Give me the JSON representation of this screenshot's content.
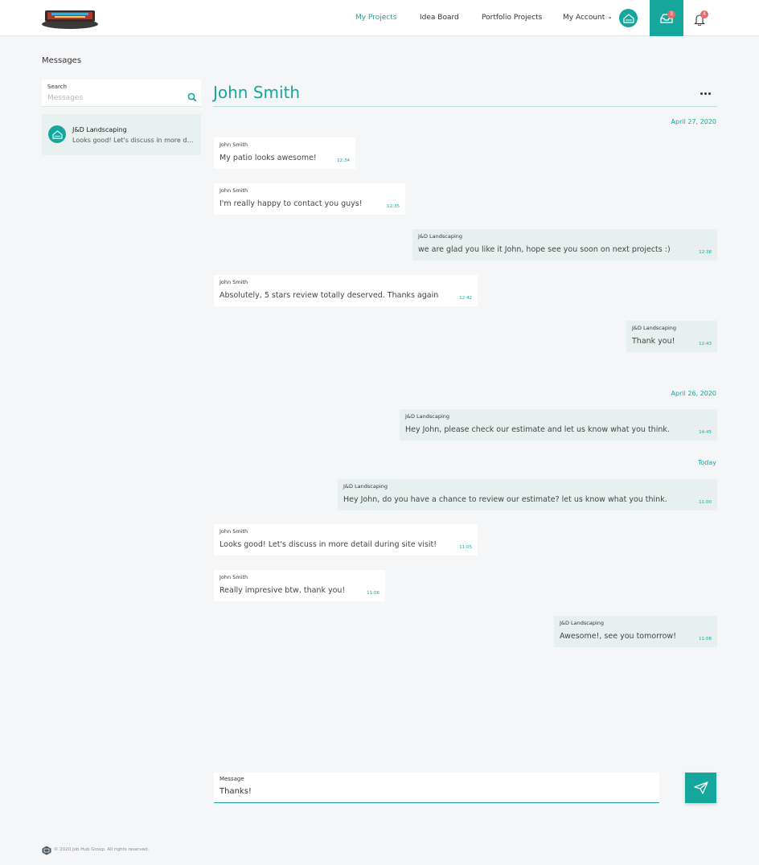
{
  "colors": {
    "accent": "#15a69c",
    "badge": "#e86a6a",
    "incoming_bg": "#ffffff",
    "outgoing_bg": "#e7efef"
  },
  "header": {
    "nav": [
      "My Projects",
      "Idea Board",
      "Portfolio Projects",
      "My Account"
    ],
    "active_nav": "My Projects",
    "inbox_badge": "3",
    "notifications_badge": "4"
  },
  "sidebar": {
    "title": "Messages",
    "search_label": "Search",
    "search_placeholder": "Messages",
    "conversations": [
      {
        "name": "J&D Landscaping",
        "preview": "Looks good! Let's discuss in more detail during site visit!"
      }
    ]
  },
  "chat": {
    "title": "John Smith",
    "dates": [
      "April 27, 2020",
      "April 26, 2020",
      "Today"
    ],
    "messages": [
      {
        "sender": "John Smith",
        "text": "My patio looks awesome!",
        "time": "12:34",
        "direction": "in"
      },
      {
        "sender": "John Smith",
        "text": "I'm really happy to contact you guys!",
        "time": "12:35",
        "direction": "in"
      },
      {
        "sender": "J&D Landscaping",
        "text": "we are glad you like it John, hope see you soon on next projects :)",
        "time": "12:38",
        "direction": "out"
      },
      {
        "sender": "John Smith",
        "text": "Absolutely, 5 stars review totally deserved. Thanks again",
        "time": "12:42",
        "direction": "in"
      },
      {
        "sender": "J&D Landscaping",
        "text": "Thank you!",
        "time": "12:43",
        "direction": "out"
      },
      {
        "sender": "J&D Landscaping",
        "text": "Hey John, please check our estimate and let us know what you think.",
        "time": "14:45",
        "direction": "out"
      },
      {
        "sender": "J&D Landscaping",
        "text": "Hey John, do you have a chance to review our estimate? let us know what you think.",
        "time": "11:00",
        "direction": "out"
      },
      {
        "sender": "John Smith",
        "text": "Looks good! Let's discuss in more detail during site visit!",
        "time": "11:05",
        "direction": "in"
      },
      {
        "sender": "John Smith",
        "text": "Really impresive btw, thank you!",
        "time": "11:06",
        "direction": "in"
      },
      {
        "sender": "J&D Landscaping",
        "text": "Awesome!, see you tomorrow!",
        "time": "11:08",
        "direction": "out"
      }
    ]
  },
  "compose": {
    "label": "Message",
    "value": "Thanks!"
  },
  "footer": {
    "text": "© 2020 Job Hub Group. All rights reserved."
  }
}
